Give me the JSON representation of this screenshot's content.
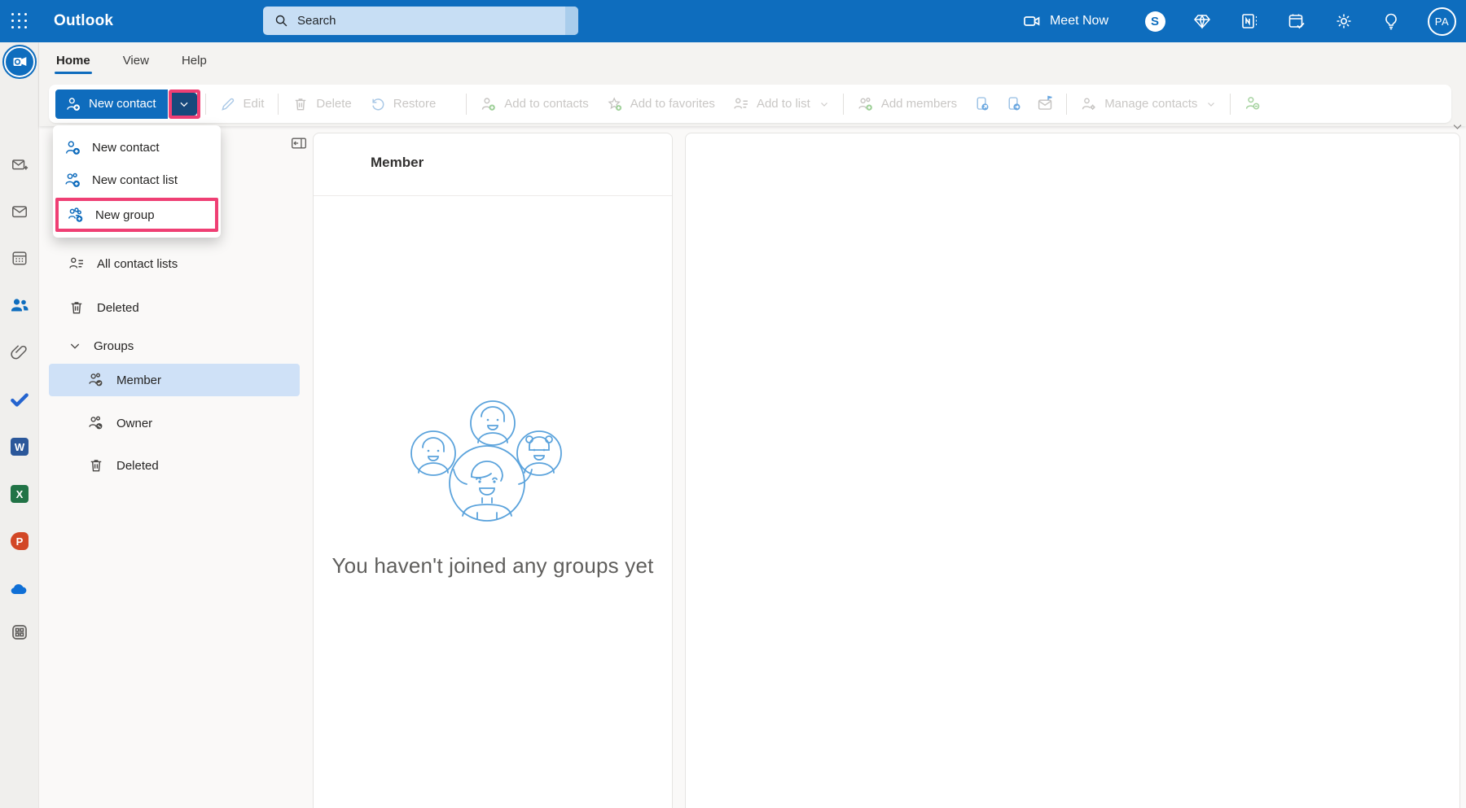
{
  "topbar": {
    "app_name": "Outlook",
    "search_placeholder": "Search",
    "meet_now_label": "Meet Now",
    "avatar_initials": "PA",
    "icon_names": [
      "app-launcher",
      "search",
      "video-camera",
      "skype",
      "premium-diamond",
      "onenote-feed",
      "my-day-calendar",
      "settings-gear",
      "tips-lightbulb",
      "account-avatar"
    ]
  },
  "ribbon": {
    "tabs": [
      {
        "label": "Home",
        "active": true
      },
      {
        "label": "View",
        "active": false
      },
      {
        "label": "Help",
        "active": false
      }
    ]
  },
  "toolbar": {
    "new_contact": {
      "label": "New contact",
      "icon": "person-add",
      "split_chevron_icon": "chevron-down",
      "chevron_highlighted": true
    },
    "buttons": [
      {
        "label": "Edit",
        "icon": "pencil",
        "disabled": true
      },
      {
        "label": "Delete",
        "icon": "trash",
        "disabled": true
      },
      {
        "label": "Restore",
        "icon": "restore-arrow",
        "disabled": true
      },
      {
        "label": "Add to contacts",
        "icon": "person-add-green",
        "disabled": true
      },
      {
        "label": "Add to favorites",
        "icon": "star-add",
        "disabled": true
      },
      {
        "label": "Add to list",
        "icon": "contact-list",
        "disabled": true,
        "has_chevron": true
      },
      {
        "label": "Add members",
        "icon": "people-add",
        "disabled": true
      },
      {
        "label": "",
        "icon": "contact-export",
        "disabled": true
      },
      {
        "label": "",
        "icon": "contact-import",
        "disabled": true
      },
      {
        "label": "",
        "icon": "mail-flag",
        "disabled": true
      },
      {
        "label": "Manage contacts",
        "icon": "person-settings",
        "disabled": true,
        "has_chevron": true
      },
      {
        "label": "",
        "icon": "person-remove",
        "disabled": true
      }
    ],
    "overflow_icon": "chevron-down"
  },
  "dropdown": {
    "items": [
      {
        "label": "New contact",
        "icon": "person-add-blue"
      },
      {
        "label": "New contact list",
        "icon": "contact-list-add-blue"
      },
      {
        "label": "New group",
        "icon": "group-add-blue",
        "highlighted": true
      }
    ]
  },
  "sidebar": {
    "collapse_icon": "collapse-pane",
    "items": [
      {
        "label": "All contact lists",
        "icon": "contact-lists"
      },
      {
        "label": "Deleted",
        "icon": "trash"
      }
    ],
    "groups_section": {
      "label": "Groups",
      "expanded": true,
      "chevron_icon": "chevron-down",
      "items": [
        {
          "label": "Member",
          "icon": "person-check",
          "selected": true
        },
        {
          "label": "Owner",
          "icon": "person-key"
        },
        {
          "label": "Deleted",
          "icon": "trash"
        }
      ]
    }
  },
  "member_panel": {
    "header": "Member",
    "empty_message": "You haven't joined any groups yet",
    "illustration": "group-of-people-illustration"
  },
  "rail": {
    "icon_names": [
      "outlook-logo",
      "new-mail",
      "mail",
      "calendar",
      "people",
      "files-paperclip",
      "to-do-check",
      "word",
      "excel",
      "powerpoint",
      "onedrive",
      "more-apps"
    ],
    "word_letter": "W",
    "excel_letter": "X",
    "powerpoint_letter": "P"
  },
  "colors": {
    "topbar_blue": "#0e6dbe",
    "accent_blue": "#0f6cbd",
    "pressed_navy": "#17497c",
    "highlight_pink": "#ef3f74",
    "selected_row_blue": "#cfe1f7",
    "search_pill_blue": "#c7def4",
    "disabled_text": "#c9c7c5",
    "illustration_blue": "#5ba3dc"
  }
}
